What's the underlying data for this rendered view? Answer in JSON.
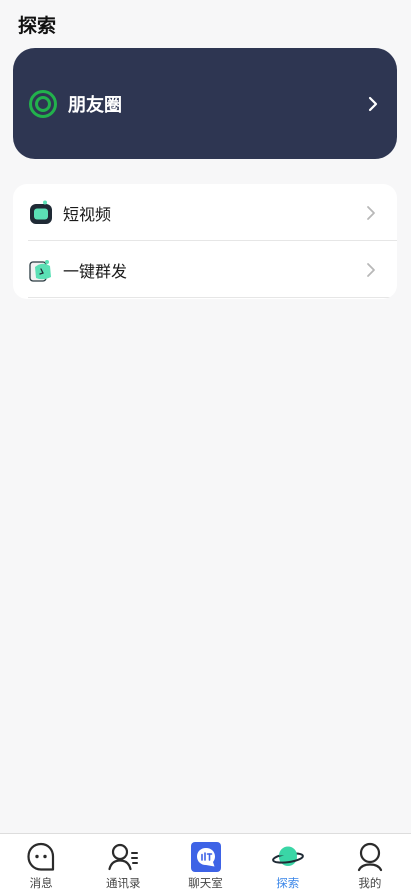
{
  "header": {
    "title": "探索"
  },
  "moments": {
    "label": "朋友圈",
    "icon": "moments-ring-icon",
    "card_color": "#2e3652",
    "accent": "#22b14c"
  },
  "list": [
    {
      "label": "短视频",
      "icon": "short-video-tv-icon"
    },
    {
      "label": "一键群发",
      "icon": "broadcast-icon"
    }
  ],
  "tabbar": {
    "active_color": "#3a86e8",
    "tabs": [
      {
        "label": "消息",
        "icon": "message-bubble-icon"
      },
      {
        "label": "通讯录",
        "icon": "contacts-icon"
      },
      {
        "label": "聊天室",
        "icon": "chatroom-icon"
      },
      {
        "label": "探索",
        "icon": "planet-icon",
        "active": true
      },
      {
        "label": "我的",
        "icon": "profile-icon"
      }
    ]
  }
}
